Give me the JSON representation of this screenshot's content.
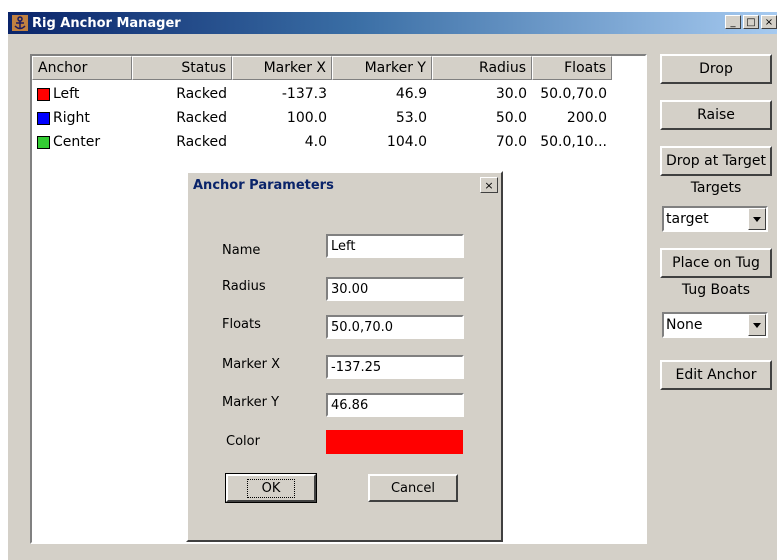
{
  "window": {
    "title": "Rig Anchor Manager",
    "controls": {
      "minimize": "_",
      "maximize": "□",
      "close": "×"
    }
  },
  "table": {
    "columns": [
      "Anchor",
      "Status",
      "Marker X",
      "Marker Y",
      "Radius",
      "Floats"
    ],
    "rows": [
      {
        "anchor": "Left",
        "color": "#ff0000",
        "status": "Racked",
        "marker_x": "-137.3",
        "marker_y": "46.9",
        "radius": "30.0",
        "floats": "50.0,70.0"
      },
      {
        "anchor": "Right",
        "color": "#0000ff",
        "status": "Racked",
        "marker_x": "100.0",
        "marker_y": "53.0",
        "radius": "50.0",
        "floats": "200.0"
      },
      {
        "anchor": "Center",
        "color": "#33cc33",
        "status": "Racked",
        "marker_x": "4.0",
        "marker_y": "104.0",
        "radius": "70.0",
        "floats": "50.0,10..."
      }
    ]
  },
  "sidebar": {
    "drop_label": "Drop",
    "raise_label": "Raise",
    "drop_target_label": "Drop at Target",
    "targets_label": "Targets",
    "targets_value": "target",
    "place_tug_label": "Place on Tug",
    "tug_boats_label": "Tug Boats",
    "tug_boats_value": "None",
    "edit_anchor_label": "Edit Anchor"
  },
  "dialog": {
    "title": "Anchor Parameters",
    "close": "×",
    "name_label": "Name",
    "name_value": "Left",
    "radius_label": "Radius",
    "radius_value": "30.00",
    "floats_label": "Floats",
    "floats_value": "50.0,70.0",
    "marker_x_label": "Marker X",
    "marker_x_value": "-137.25",
    "marker_y_label": "Marker Y",
    "marker_y_value": "46.86",
    "color_label": "Color",
    "color_value": "#ff0000",
    "ok_label": "OK",
    "cancel_label": "Cancel"
  },
  "icons": {
    "app": "anchor-icon",
    "dropdown": "chevron-down-icon"
  }
}
